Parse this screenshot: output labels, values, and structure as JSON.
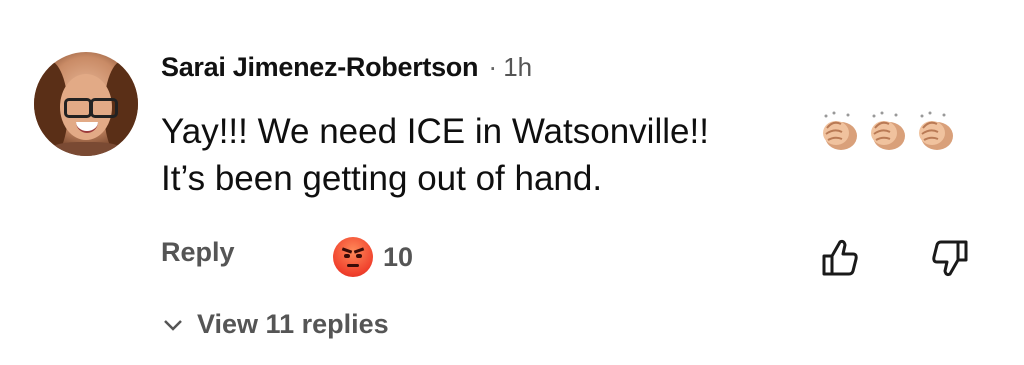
{
  "comment": {
    "author": "Sarai Jimenez-Robertson",
    "separator": "·",
    "time": "1h",
    "text_line1": "Yay!!! We need ICE in Watsonville!!",
    "text_line2": "It’s been getting out of hand.",
    "emojis": [
      "clapping-hands-icon",
      "clapping-hands-icon",
      "clapping-hands-icon"
    ]
  },
  "actions": {
    "reply_label": "Reply",
    "reaction_icon": "angry-face-icon",
    "reaction_count": "10",
    "like_icon": "thumbs-up-icon",
    "dislike_icon": "thumbs-down-icon",
    "view_replies_label": "View 11 replies"
  },
  "colors": {
    "background": "#ffffff",
    "text": "#0f0f0f",
    "muted": "#555555",
    "angry": "#f0402c"
  }
}
